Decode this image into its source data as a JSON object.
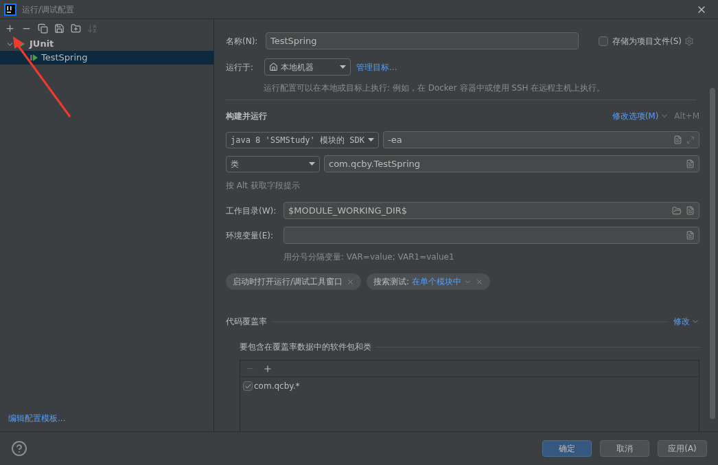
{
  "window": {
    "title": "运行/调试配置"
  },
  "toolbar": [
    {
      "kind": "add",
      "disabled": false
    },
    {
      "kind": "remove",
      "disabled": false
    },
    {
      "kind": "copy",
      "disabled": false
    },
    {
      "kind": "save",
      "disabled": false
    },
    {
      "kind": "folder",
      "disabled": false
    },
    {
      "kind": "sort",
      "disabled": true
    }
  ],
  "tree": [
    {
      "label": "JUnit",
      "expanded": true,
      "selected": false,
      "children": [
        {
          "label": "TestSpring",
          "selected": true
        }
      ]
    }
  ],
  "edit_templates_link": "编辑配置模板...",
  "form": {
    "name_label": "名称(N):",
    "name_value": "TestSpring",
    "store_label": "存储为项目文件(S)",
    "store_checked": false,
    "run_on_label": "运行于:",
    "run_on_value": "本地机器",
    "manage_link": "管理目标...",
    "run_on_hint": "运行配置可以在本地或目标上执行: 例如，在 Docker 容器中或使用 SSH 在远程主机上执行。",
    "build_title": "构建并运行",
    "modify_options": "修改选项(M)",
    "modify_shortcut": "Alt+M",
    "jre_value": "java 8 'SSMStudy' 模块的 SDK",
    "vm_options": "-ea",
    "test_kind": "类",
    "class_value": "com.qcby.TestSpring",
    "alt_hint": "按 Alt 获取字段提示",
    "workdir_label": "工作目录(W):",
    "workdir_value": "$MODULE_WORKING_DIR$",
    "env_label": "环境变量(E):",
    "env_hint": "用分号分隔变量: VAR=value; VAR1=value1",
    "chips": [
      {
        "label": "启动时打开运行/调试工具窗口"
      },
      {
        "label": "搜索测试:",
        "value": "在单个模块中"
      }
    ],
    "coverage_title": "代码覆盖率",
    "coverage_modify": "修改",
    "coverage_sub": "要包含在覆盖率数据中的软件包和类",
    "coverage_items": [
      {
        "label": "com.qcby.*",
        "checked": true
      }
    ]
  },
  "buttons": [
    {
      "label": "确定",
      "selected": true
    },
    {
      "label": "取消",
      "selected": false
    },
    {
      "label": "应用(A)",
      "selected": false
    }
  ]
}
